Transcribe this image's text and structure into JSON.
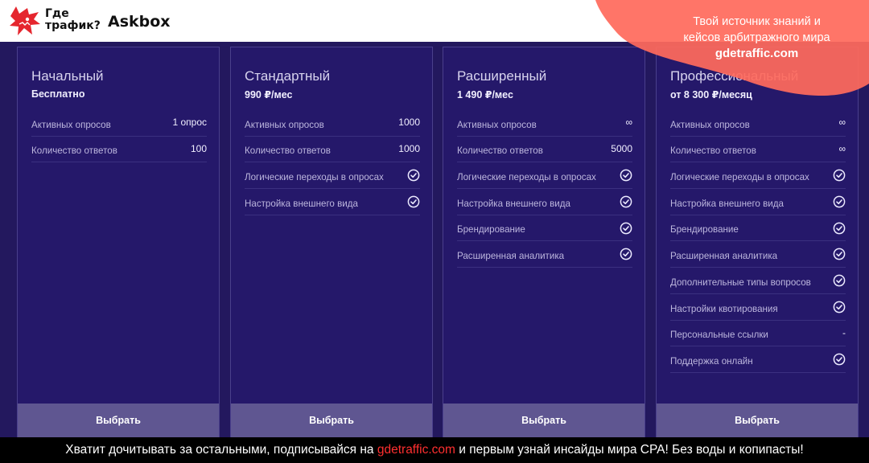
{
  "header": {
    "logo_line1": "Где",
    "logo_line2": "трафик?",
    "product": "Askbox"
  },
  "select_label": "Выбрать",
  "plans": [
    {
      "title": "Начальный",
      "price": "Бесплатно",
      "features": [
        {
          "label": "Активных опросов",
          "value": "1 опрос"
        },
        {
          "label": "Количество ответов",
          "value": "100"
        }
      ]
    },
    {
      "title": "Стандартный",
      "price": "990 ₽/мес",
      "features": [
        {
          "label": "Активных опросов",
          "value": "1000"
        },
        {
          "label": "Количество ответов",
          "value": "1000"
        },
        {
          "label": "Логические переходы в опросах",
          "check": true
        },
        {
          "label": "Настройка внешнего вида",
          "check": true
        }
      ]
    },
    {
      "title": "Расширенный",
      "price": "1 490 ₽/мес",
      "features": [
        {
          "label": "Активных опросов",
          "value": "∞"
        },
        {
          "label": "Количество ответов",
          "value": "5000"
        },
        {
          "label": "Логические переходы в опросах",
          "check": true
        },
        {
          "label": "Настройка внешнего вида",
          "check": true
        },
        {
          "label": "Брендирование",
          "check": true
        },
        {
          "label": "Расширенная аналитика",
          "check": true
        }
      ]
    },
    {
      "title": "Профессиональный",
      "price": "от 8 300 ₽/месяц",
      "features": [
        {
          "label": "Активных опросов",
          "value": "∞"
        },
        {
          "label": "Количество ответов",
          "value": "∞"
        },
        {
          "label": "Логические переходы в опросах",
          "check": true
        },
        {
          "label": "Настройка внешнего вида",
          "check": true
        },
        {
          "label": "Брендирование",
          "check": true
        },
        {
          "label": "Расширенная аналитика",
          "check": true
        },
        {
          "label": "Дополнительные типы вопросов",
          "check": true
        },
        {
          "label": "Настройки квотирования",
          "check": true
        },
        {
          "label": "Персональные ссылки",
          "value": "-"
        },
        {
          "label": "Поддержка онлайн",
          "check": true
        }
      ]
    }
  ],
  "promo": {
    "line1": "Твой источник знаний и",
    "line2": "кейсов арбитражного мира",
    "link": "gdetraffic.com"
  },
  "footer": {
    "before": "Хватит дочитывать за остальными, подписывайся на ",
    "link": "gdetraffic.com",
    "after": " и первым узнай инсайды мира CPA! Без воды и копипасты!"
  },
  "colors": {
    "background": "#23185e",
    "card": "#25186a",
    "button": "#5f5691",
    "promo_blob": "#ff6a5c",
    "footer_highlight": "#ff2f2f"
  },
  "icons": {
    "logo": "shark-logo-icon",
    "check": "check-circle-icon"
  }
}
